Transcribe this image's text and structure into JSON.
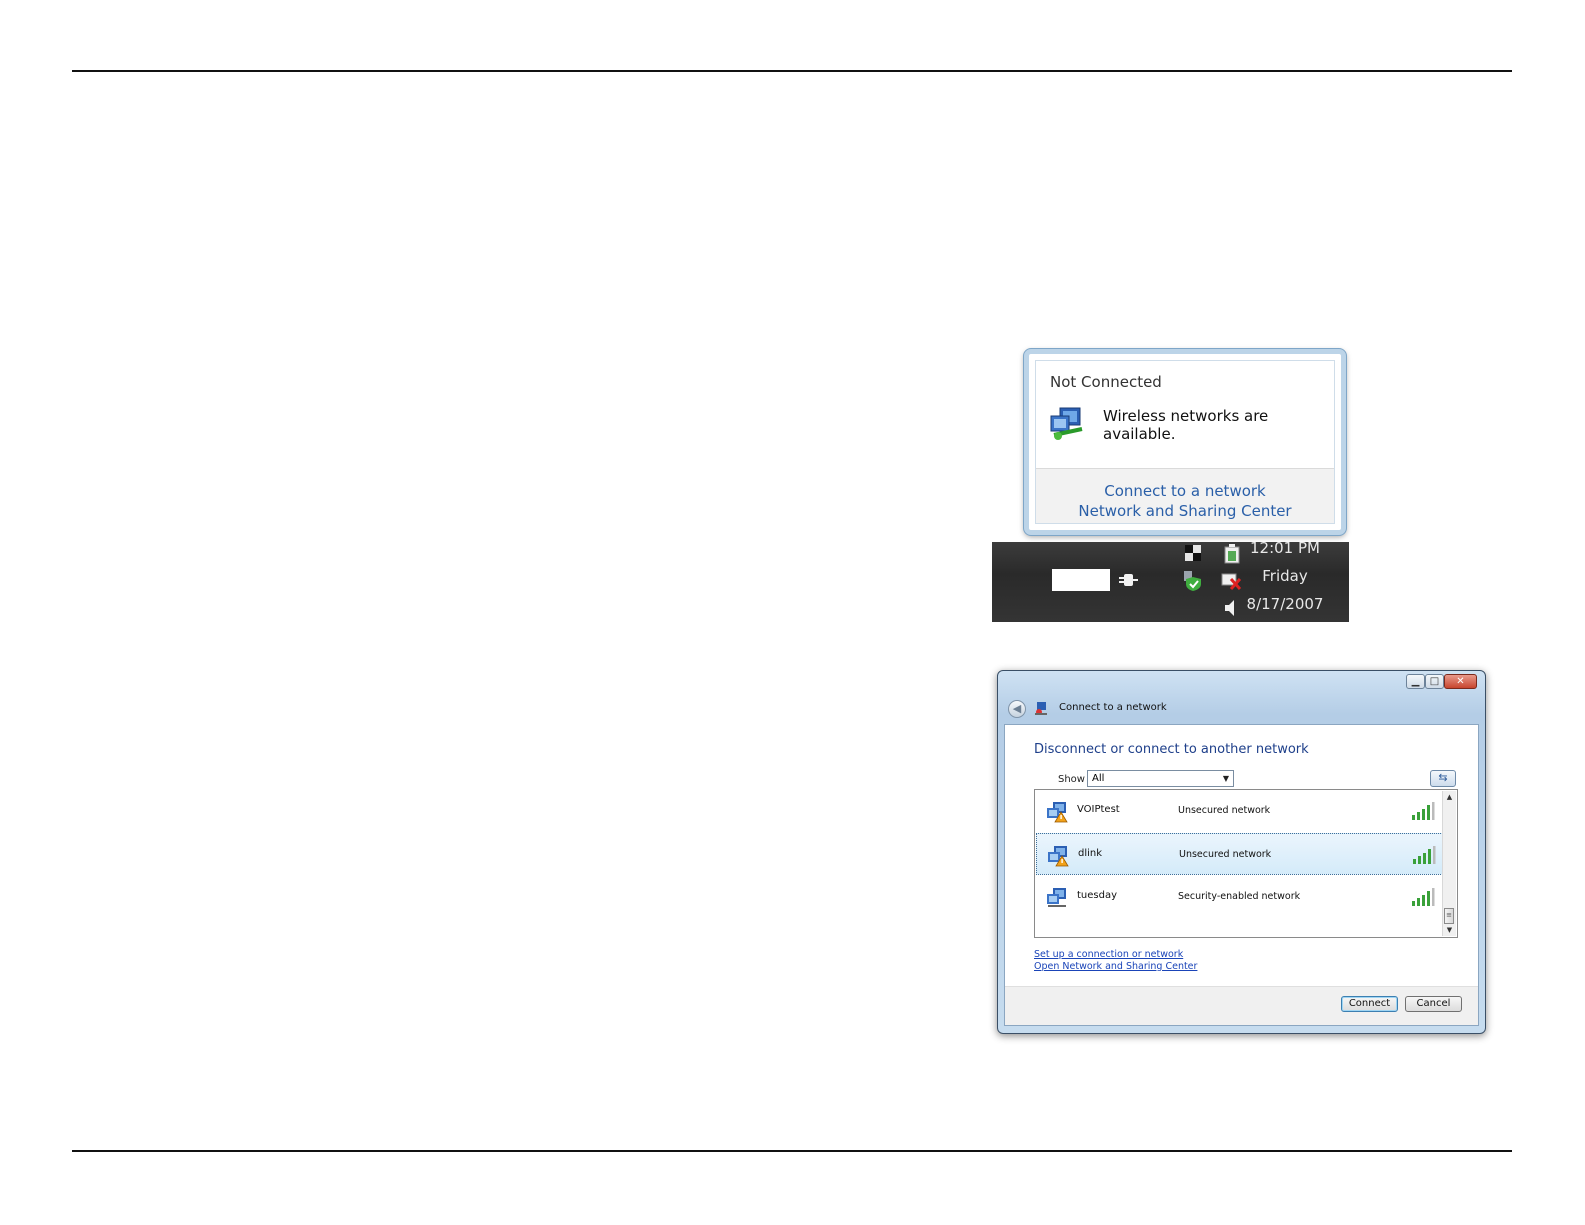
{
  "balloon": {
    "title": "Not Connected",
    "message": "Wireless networks are available.",
    "links": [
      "Connect to a network",
      "Network and Sharing Center"
    ],
    "icon": "network-warning-icon"
  },
  "tray": {
    "time": "12:01 PM",
    "day": "Friday",
    "date": "8/17/2007",
    "icons": [
      "power-plug-icon",
      "network-icon",
      "security-shield-icon",
      "battery-icon",
      "network-disconnected-icon",
      "volume-icon"
    ]
  },
  "window": {
    "title": "Connect to a network",
    "controls": [
      "minimize",
      "maximize",
      "close"
    ],
    "heading": "Disconnect or connect to another network",
    "show_label": "Show",
    "show_value": "All",
    "networks": [
      {
        "name": "VOIPtest",
        "security": "Unsecured network",
        "selected": false
      },
      {
        "name": "dlink",
        "security": "Unsecured network",
        "selected": true
      },
      {
        "name": "tuesday",
        "security": "Security-enabled network",
        "selected": false
      }
    ],
    "links": [
      "Set up a connection or network",
      "Open Network and Sharing Center"
    ],
    "connect_label": "Connect",
    "cancel_label": "Cancel"
  },
  "colors": {
    "link": "#2a5fa8",
    "heading": "#1e3f8a",
    "taskbar": "#333333",
    "selection": "#d4ebfa"
  }
}
